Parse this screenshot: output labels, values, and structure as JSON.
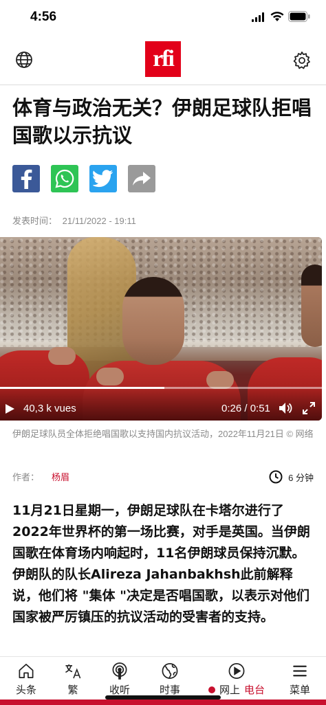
{
  "status_bar": {
    "time": "4:56"
  },
  "header": {
    "logo_text": "rfi"
  },
  "article": {
    "title": "体育与政治无关？伊朗足球队拒唱国歌以示抗议",
    "published_label": "发表时间：",
    "published_value": "21/11/2022 - 19:11",
    "share": [
      "facebook-icon",
      "whatsapp-icon",
      "twitter-icon",
      "share-icon"
    ],
    "video": {
      "views": "40,3 k vues",
      "time": "0:26 / 0:51",
      "progress": 0.51
    },
    "caption": "伊朗足球队员全体拒绝唱国歌以支持国内抗议活动，2022年11月21日 © 网络",
    "author_label": "作者：",
    "author_name": "杨眉",
    "read_time": "6 分钟",
    "body": "11月21日星期一，伊朗足球队在卡塔尔进行了2022年世界杯的第一场比赛，对手是英国。当伊朗国歌在体育场内响起时，11名伊朗球员保持沉默。伊朗队的队长Alireza Jahanbakhsh此前解释说，他们将 \"集体 \"决定是否唱国歌，以表示对他们国家被严厉镇压的抗议活动的受害者的支持。"
  },
  "bottom_nav": {
    "items": [
      {
        "label": "头条",
        "icon": "home-icon"
      },
      {
        "label": "繁",
        "icon": "translate-icon"
      },
      {
        "label": "收听",
        "icon": "podcast-icon"
      },
      {
        "label": "时事",
        "icon": "globe-icon"
      },
      {
        "label": "网上",
        "station": "电台",
        "icon": "play-circle-icon"
      },
      {
        "label": "菜单",
        "icon": "menu-icon"
      }
    ]
  },
  "colors": {
    "brand": "#e20019",
    "accent": "#c8102e"
  }
}
